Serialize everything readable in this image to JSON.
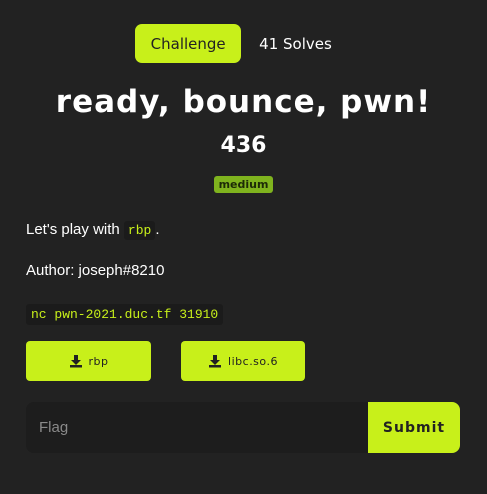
{
  "tabs": {
    "challenge_label": "Challenge",
    "solves_label": "41 Solves"
  },
  "challenge": {
    "title": "ready, bounce, pwn!",
    "points": "436",
    "difficulty": "medium",
    "description_prefix": "Let's play with",
    "description_code": "rbp",
    "description_suffix": ".",
    "author": "Author: joseph#8210",
    "connection": "nc pwn-2021.duc.tf 31910"
  },
  "files": [
    {
      "label": "rbp",
      "icon": "download-icon"
    },
    {
      "label": "libc.so.6",
      "icon": "download-icon"
    }
  ],
  "flag_form": {
    "placeholder": "Flag",
    "submit_label": "Submit"
  },
  "colors": {
    "background": "#222222",
    "accent": "#c8f01a",
    "badge": "#7fb31e"
  }
}
